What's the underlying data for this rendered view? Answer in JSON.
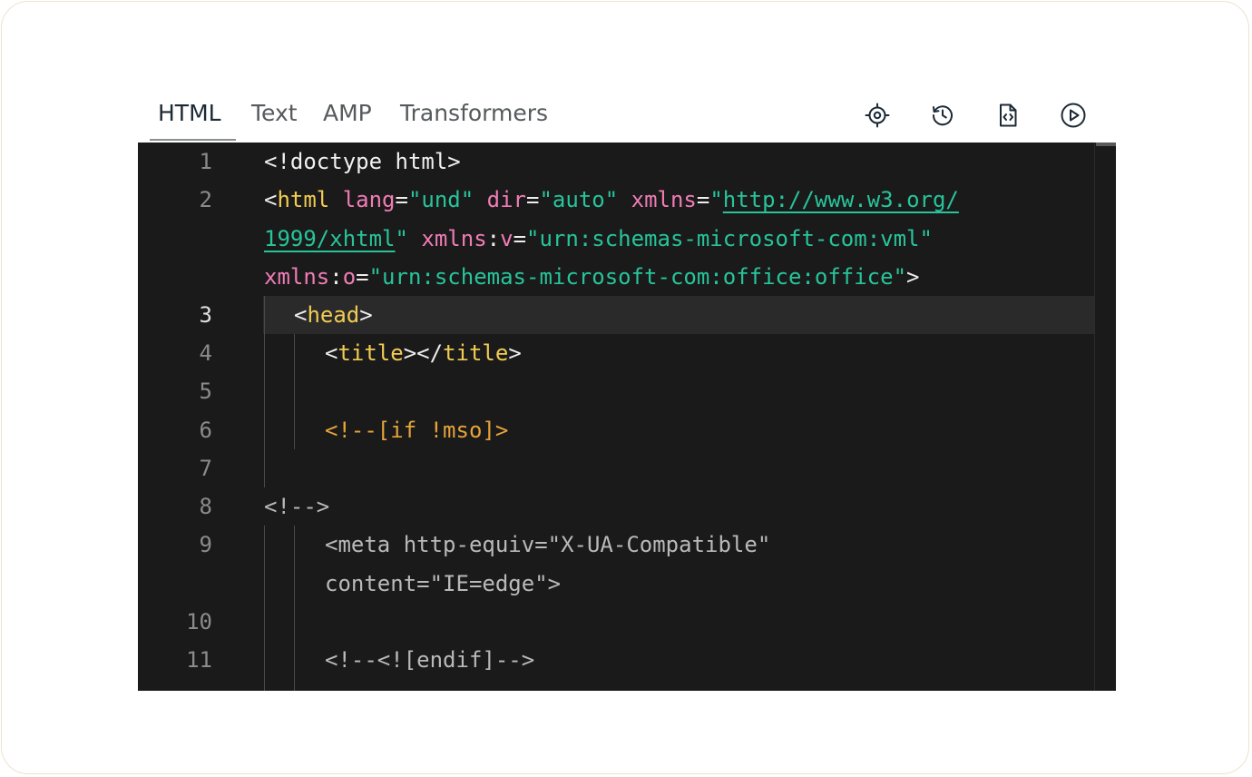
{
  "tabs": [
    {
      "label": "HTML",
      "active": true
    },
    {
      "label": "Text",
      "active": false
    },
    {
      "label": "AMP",
      "active": false
    },
    {
      "label": "Transformers",
      "active": false
    }
  ],
  "toolbar_icons": [
    "target-icon",
    "history-icon",
    "code-file-icon",
    "play-icon"
  ],
  "gutter": [
    "1",
    "2",
    "3",
    "4",
    "5",
    "6",
    "7",
    "8",
    "9",
    "10",
    "11"
  ],
  "current_line": "3",
  "code": {
    "l1": {
      "a": "<!doctype html>"
    },
    "l2": {
      "a": "<",
      "b": "html",
      "c": " ",
      "d": "lang",
      "e": "=",
      "f": "\"und\"",
      "g": " ",
      "h": "dir",
      "i": "=",
      "j": "\"auto\"",
      "k": " ",
      "l": "xmlns",
      "m": "=",
      "n": "\"",
      "o": "http://www.w3.org/"
    },
    "l2b": {
      "a": "1999/xhtml",
      "b": "\"",
      "c": " ",
      "d": "xmlns",
      "e": ":",
      "f": "v",
      "g": "=",
      "h": "\"urn:schemas-microsoft-com:vml\""
    },
    "l2c": {
      "a": "xmlns",
      "b": ":",
      "c": "o",
      "d": "=",
      "e": "\"urn:schemas-microsoft-com:office:office\"",
      "f": ">"
    },
    "l3": {
      "a": "<",
      "b": "head",
      "c": ">"
    },
    "l4": {
      "a": "<",
      "b": "title",
      "c": "></",
      "d": "title",
      "e": ">"
    },
    "l6": {
      "a": "<!--[if !mso]>"
    },
    "l8": {
      "a": "<!-->"
    },
    "l9a": {
      "a": "<meta http-equiv=\"X-UA-Compatible\""
    },
    "l9b": {
      "a": "content=\"IE=edge\">"
    },
    "l11": {
      "a": "<!--<![endif]-->"
    }
  },
  "colors": {
    "editor_bg": "#1a1a1a",
    "tag": "#f2cb53",
    "attribute": "#f07cb6",
    "string": "#27c49b",
    "conditional_comment": "#e6a33a"
  }
}
